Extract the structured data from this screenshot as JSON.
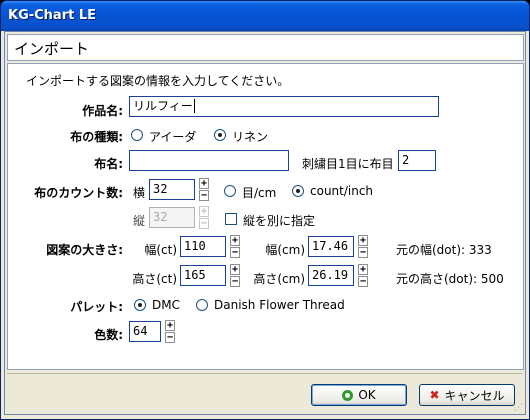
{
  "window": {
    "title": "KG-Chart LE"
  },
  "page": {
    "heading": "インポート",
    "instruction": "インポートする図案の情報を入力してください。"
  },
  "work_name": {
    "label": "作品名:",
    "value": "リルフィー"
  },
  "fabric_type": {
    "label": "布の種類:",
    "options": [
      "アイーダ",
      "リネン"
    ],
    "selected": "リネン"
  },
  "fabric_name": {
    "label": "布名:",
    "value": ""
  },
  "stitch": {
    "label": "刺繍目1目に布目",
    "value": "2"
  },
  "count": {
    "label": "布のカウント数:",
    "horizontal_label": "横",
    "horizontal_value": "32",
    "vertical_label": "縦",
    "vertical_value": "32",
    "unit_options": [
      "目/cm",
      "count/inch"
    ],
    "selected_unit": "count/inch",
    "separate_label": "縦を別に指定",
    "separate_checked": false
  },
  "size": {
    "label": "図案の大きさ:",
    "width_ct_label": "幅(ct)",
    "width_ct_value": "110",
    "width_cm_label": "幅(cm)",
    "width_cm_value": "17.46",
    "width_dot_text": "元の幅(dot): 333",
    "height_ct_label": "高さ(ct)",
    "height_ct_value": "165",
    "height_cm_label": "高さ(cm)",
    "height_cm_value": "26.19",
    "height_dot_text": "元の高さ(dot): 500"
  },
  "palette": {
    "label": "パレット:",
    "options": [
      "DMC",
      "Danish Flower Thread"
    ],
    "selected": "DMC"
  },
  "colors": {
    "label": "色数:",
    "value": "64"
  },
  "spin": {
    "up": "+",
    "down": "−"
  },
  "buttons": {
    "ok": "OK",
    "cancel": "キャンセル"
  },
  "icons": {
    "ok": "ok-circle-icon",
    "cancel": "red-x-icon",
    "spinner": "plus-minus-spinner"
  }
}
